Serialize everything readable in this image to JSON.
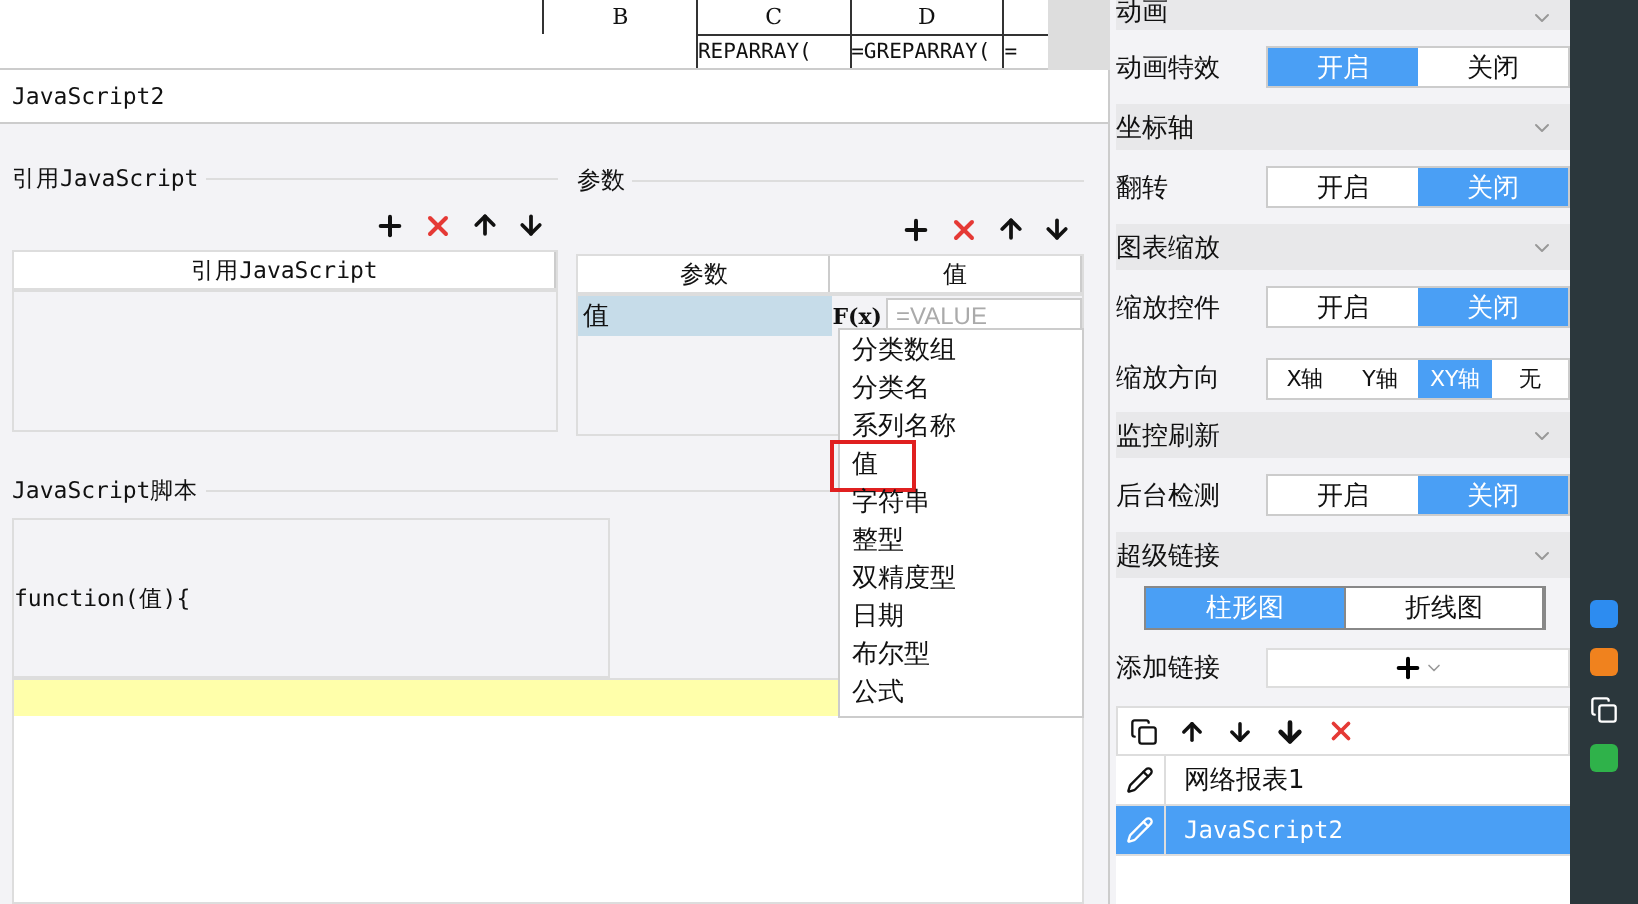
{
  "spreadsheet": {
    "columns": [
      {
        "label": "B"
      },
      {
        "label": "C"
      },
      {
        "label": "D"
      }
    ],
    "cells": [
      "REPARRAY(",
      "=GREPARRAY(",
      "="
    ]
  },
  "dialog": {
    "title": "JavaScript2",
    "references": {
      "title": "引用JavaScript",
      "column": "引用JavaScript"
    },
    "params": {
      "title": "参数",
      "columns": [
        "参数",
        "值"
      ],
      "rows": [
        {
          "name": "值",
          "formula_label": "F(x)",
          "placeholder": "=VALUE",
          "selected": true
        }
      ]
    },
    "type_menu": {
      "items": [
        {
          "label": "分类数组",
          "highlighted": false
        },
        {
          "label": "分类名",
          "highlighted": false
        },
        {
          "label": "系列名称",
          "highlighted": false
        },
        {
          "label": "值",
          "highlighted": true
        },
        {
          "label": "字符串",
          "highlighted": false
        },
        {
          "label": "整型",
          "highlighted": false
        },
        {
          "label": "双精度型",
          "highlighted": false
        },
        {
          "label": "日期",
          "highlighted": false
        },
        {
          "label": "布尔型",
          "highlighted": false
        },
        {
          "label": "公式",
          "highlighted": false
        }
      ]
    },
    "script": {
      "title": "JavaScript脚本",
      "header": "function(值){"
    }
  },
  "panel": {
    "sections": [
      {
        "title": "动画",
        "rows": [
          {
            "kind": "toggle",
            "label": "动画特效",
            "options": [
              {
                "label": "开启",
                "selected": true
              },
              {
                "label": "关闭",
                "selected": false
              }
            ]
          }
        ]
      },
      {
        "title": "坐标轴",
        "rows": [
          {
            "kind": "toggle",
            "label": "翻转",
            "options": [
              {
                "label": "开启",
                "selected": false
              },
              {
                "label": "关闭",
                "selected": true
              }
            ]
          }
        ]
      },
      {
        "title": "图表缩放",
        "rows": [
          {
            "kind": "toggle",
            "label": "缩放控件",
            "options": [
              {
                "label": "开启",
                "selected": false
              },
              {
                "label": "关闭",
                "selected": true
              }
            ]
          },
          {
            "kind": "compact",
            "label": "缩放方向",
            "options": [
              {
                "label": "X轴",
                "selected": false
              },
              {
                "label": "Y轴",
                "selected": false
              },
              {
                "label": "XY轴",
                "selected": true
              },
              {
                "label": "无",
                "selected": false
              }
            ]
          }
        ]
      },
      {
        "title": "监控刷新",
        "rows": [
          {
            "kind": "toggle",
            "label": "后台检测",
            "options": [
              {
                "label": "开启",
                "selected": false
              },
              {
                "label": "关闭",
                "selected": true
              }
            ]
          }
        ]
      },
      {
        "title": "超级链接"
      }
    ],
    "link_tabs": [
      {
        "label": "柱形图",
        "selected": true
      },
      {
        "label": "折线图",
        "selected": false
      }
    ],
    "add_link": {
      "label": "添加链接"
    },
    "links": [
      {
        "label": "网络报表1",
        "selected": false
      },
      {
        "label": "JavaScript2",
        "selected": true
      }
    ]
  }
}
